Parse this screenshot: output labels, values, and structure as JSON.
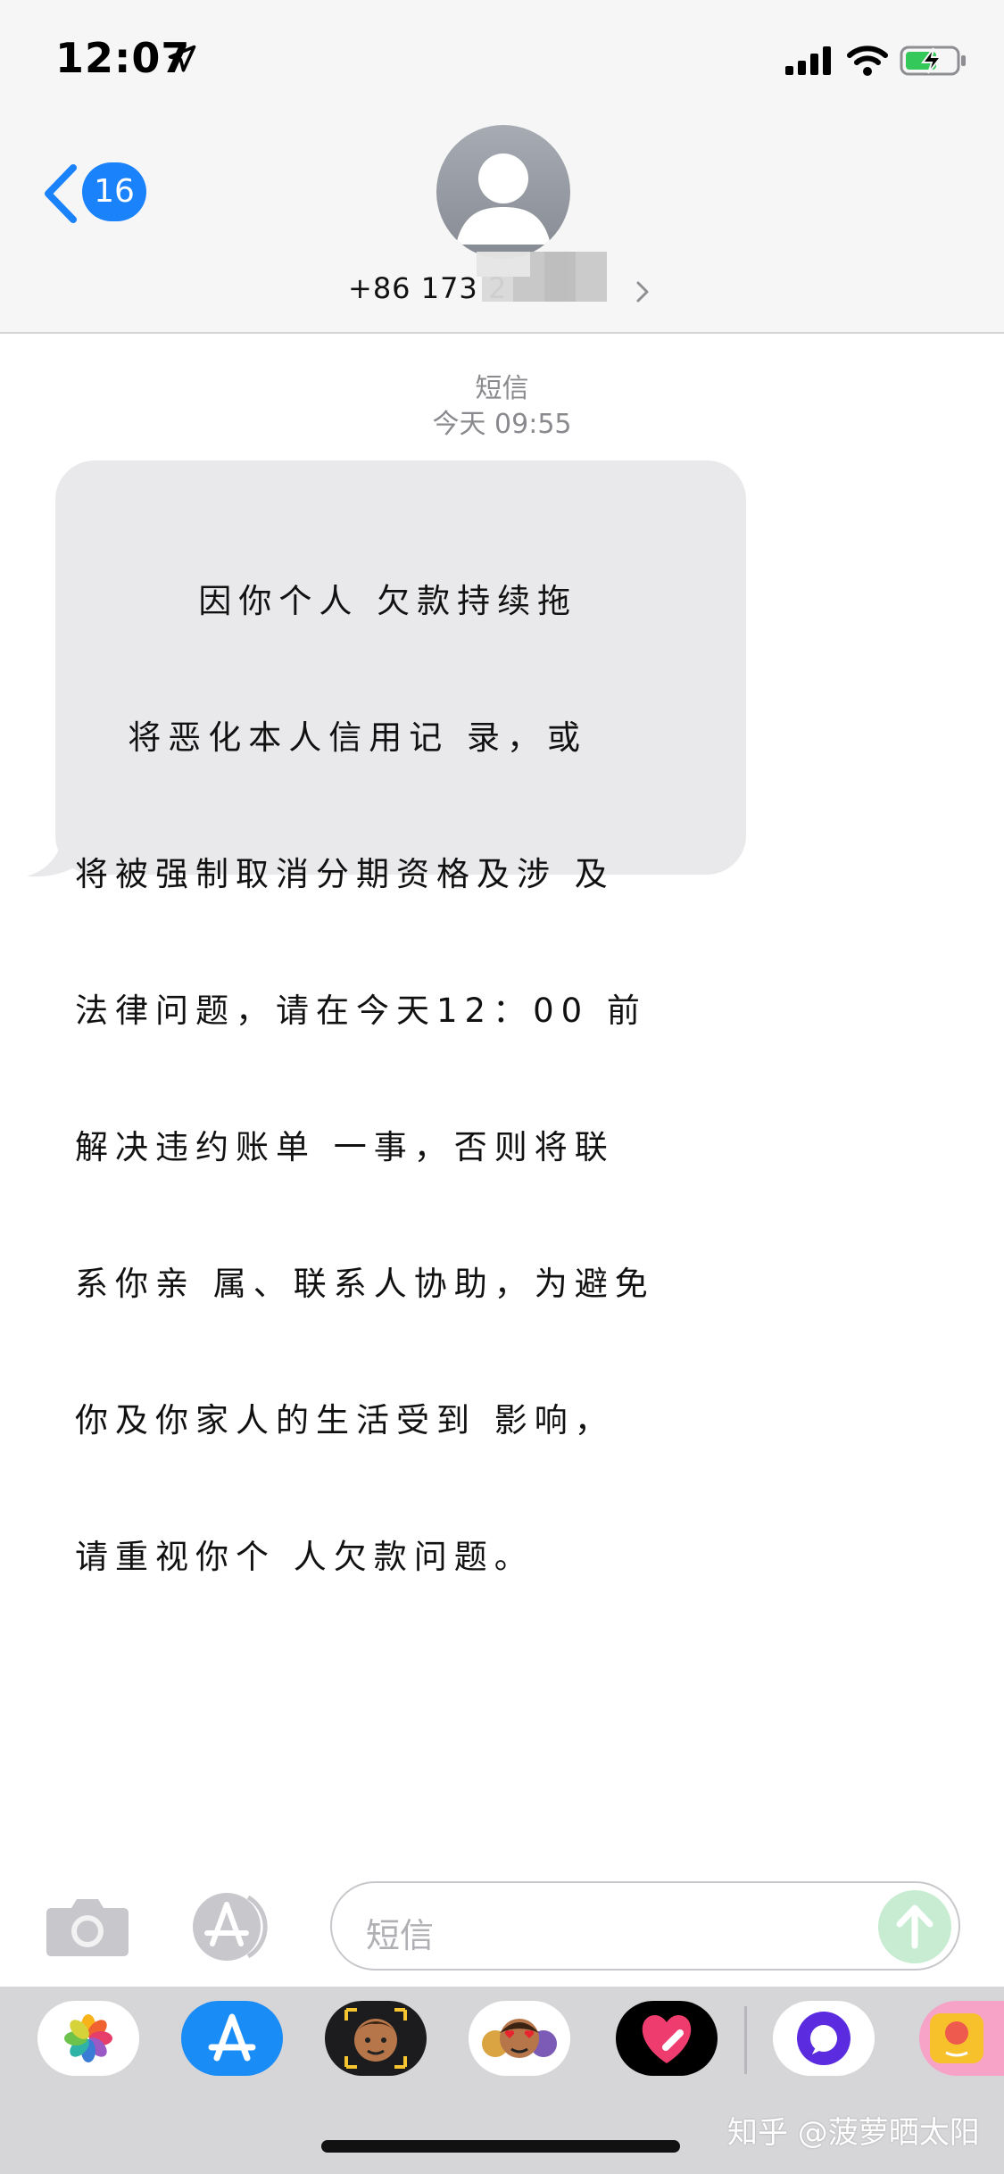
{
  "status_bar": {
    "time": "12:07"
  },
  "header": {
    "back_badge": "16",
    "contact_number": "+86 173 2"
  },
  "conversation": {
    "service_label": "短信",
    "timestamp": "今天 09:55",
    "message_lines": [
      "       因你个人 欠款持续拖",
      "   将恶化本人信用记 录，或",
      "将被强制取消分期资格及涉 及",
      "法律问题，请在今天12：00 前",
      "解决违约账单 一事，否则将联",
      "系你亲 属、联系人协助，为避免",
      "你及你家人的生活受到 影响，",
      "请重视你个 人欠款问题。"
    ]
  },
  "input_bar": {
    "placeholder": "短信"
  },
  "app_drawer": {
    "apps": [
      "photos-app-icon",
      "app-store-app-icon",
      "memoji-camera-app-icon",
      "memoji-stickers-app-icon",
      "digital-touch-app-icon",
      "purple-chat-app-icon",
      "pink-sticker-app-icon"
    ]
  },
  "watermark": "知乎 @菠萝晒太阳",
  "colors": {
    "accent": "#1a82fb",
    "bubble": "#e9e9eb",
    "send": "#c7ecd2"
  }
}
